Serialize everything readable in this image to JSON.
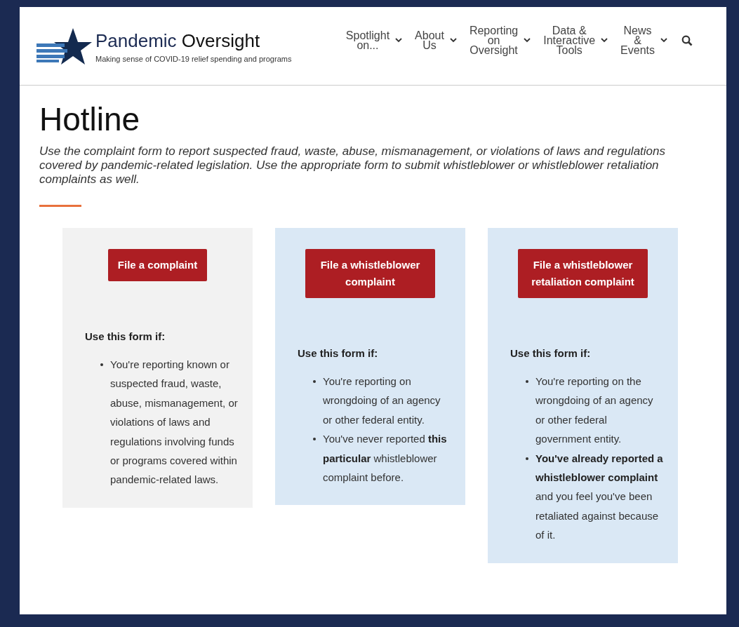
{
  "site": {
    "name_light": "Pandemic",
    "name_bold": "Oversight",
    "tagline": "Making sense of COVID-19 relief spending and programs"
  },
  "nav": [
    {
      "label": "Spotlight\non..."
    },
    {
      "label": "About\nUs"
    },
    {
      "label": "Reporting\non\nOversight"
    },
    {
      "label": "Data &\nInteractive\nTools"
    },
    {
      "label": "News\n&\nEvents"
    }
  ],
  "page": {
    "title": "Hotline",
    "intro": "Use the complaint form to report suspected fraud, waste, abuse, mismanagement, or violations of laws and regulations covered by pandemic-related legislation. Use the appropriate form to submit whistleblower or whistleblower retaliation complaints as well."
  },
  "cards": [
    {
      "color": "#f2f2f2",
      "button": "File a complaint",
      "heading": "Use this form if:",
      "bullets": [
        "You're reporting known or suspected fraud, waste, abuse, mismanagement, or violations of laws and regulations involving funds or programs covered within pandemic-related laws."
      ]
    },
    {
      "color": "#dae8f5",
      "button": "File a whistleblower complaint",
      "heading": "Use this form if:",
      "bullets": [
        "You're reporting on wrongdoing of an agency or other federal entity.",
        "You've never reported **this particular** whistleblower complaint before."
      ]
    },
    {
      "color": "#dae8f5",
      "button": "File a whistleblower retaliation complaint",
      "heading": "Use this form if:",
      "bullets": [
        "You're reporting on the wrongdoing of an agency or other federal government entity.",
        "**You've already reported a whistleblower complaint** and you feel you've been retaliated against because of it."
      ]
    }
  ]
}
